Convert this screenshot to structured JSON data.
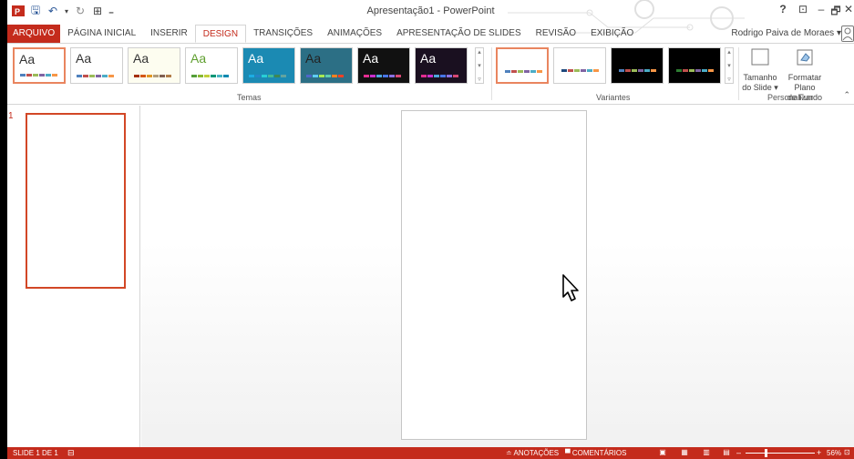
{
  "window": {
    "title": "Apresentação1 - PowerPoint",
    "help": "?",
    "ribbon_display": "⊡",
    "minimize": "–",
    "restore": "🗗",
    "close": "✕"
  },
  "qat": {
    "app_icon": "powerpoint-icon",
    "save": "🖫",
    "undo": "↶",
    "undo_dropdown": "▾",
    "redo": "↻",
    "start_slideshow": "⊞",
    "customize": "₌"
  },
  "tabs": [
    "ARQUIVO",
    "PÁGINA INICIAL",
    "INSERIR",
    "DESIGN",
    "TRANSIÇÕES",
    "ANIMAÇÕES",
    "APRESENTAÇÃO DE SLIDES",
    "REVISÃO",
    "EXIBIÇÃO"
  ],
  "active_tab": "DESIGN",
  "user": {
    "name": "Rodrigo Paiva de Moraes",
    "dropdown": "▾"
  },
  "ribbon": {
    "themes_label": "Temas",
    "theme_text": "Aa",
    "variants_label": "Variantes",
    "customize_label": "Personalizar",
    "slide_size_label_1": "Tamanho",
    "slide_size_label_2": "do Slide ▾",
    "format_bg_label_1": "Formatar Plano",
    "format_bg_label_2": "de Fundo",
    "collapse": "⌃",
    "scroll_up": "▴",
    "scroll_down": "▾",
    "scroll_more": "▿"
  },
  "themes": [
    {
      "bg": "#ffffff",
      "text": "#333333",
      "selected": true,
      "bars": [
        "#4f81bd",
        "#c0504d",
        "#9bbb59",
        "#8064a2",
        "#4bacc6",
        "#f79646"
      ]
    },
    {
      "bg": "#ffffff",
      "text": "#333333",
      "selected": false,
      "bars": [
        "#4f81bd",
        "#c0504d",
        "#9bbb59",
        "#8064a2",
        "#4bacc6",
        "#f79646"
      ]
    },
    {
      "bg": "#fdfdf0",
      "text": "#333333",
      "selected": false,
      "bars": [
        "#a5300f",
        "#d55816",
        "#e19825",
        "#b19c7d",
        "#7f5f52",
        "#b27d49"
      ]
    },
    {
      "bg": "#ffffff",
      "text": "#5f9f2f",
      "selected": false,
      "bars": [
        "#549e39",
        "#8ab833",
        "#c0cf3a",
        "#029676",
        "#4ab5c4",
        "#0989b1"
      ]
    },
    {
      "bg": "#1b8ab3",
      "text": "#ffffff",
      "selected": false,
      "bars": [
        "#1cade4",
        "#2683c6",
        "#27ced7",
        "#42ba97",
        "#3e8853",
        "#62a39f"
      ]
    },
    {
      "bg": "#2c6f85",
      "text": "#222222",
      "selected": false,
      "bars": [
        "#4e67c8",
        "#5eccf3",
        "#a7ea52",
        "#5dceaf",
        "#ff8021",
        "#f14124"
      ]
    },
    {
      "bg": "#111111",
      "text": "#ffffff",
      "selected": false,
      "bars": [
        "#e32d91",
        "#c830cc",
        "#4ea6dc",
        "#4775e7",
        "#8971e1",
        "#d54773"
      ]
    },
    {
      "bg": "#1a1020",
      "text": "#ffffff",
      "selected": false,
      "bars": [
        "#e32d91",
        "#c830cc",
        "#4ea6dc",
        "#4775e7",
        "#8971e1",
        "#d54773"
      ]
    }
  ],
  "variants": [
    {
      "bg": "#ffffff",
      "selected": true,
      "bars": [
        "#4f81bd",
        "#c0504d",
        "#9bbb59",
        "#8064a2",
        "#4bacc6",
        "#f79646"
      ]
    },
    {
      "bg": "#ffffff",
      "selected": false,
      "bars": [
        "#1f497d",
        "#c0504d",
        "#9bbb59",
        "#8064a2",
        "#4bacc6",
        "#f79646"
      ]
    },
    {
      "bg": "#000000",
      "selected": false,
      "bars": [
        "#4f81bd",
        "#c0504d",
        "#9bbb59",
        "#8064a2",
        "#4bacc6",
        "#f79646"
      ]
    },
    {
      "bg": "#000000",
      "selected": false,
      "bars": [
        "#2e7d32",
        "#c0504d",
        "#9bbb59",
        "#8064a2",
        "#4bacc6",
        "#f79646"
      ]
    }
  ],
  "slides_pane": {
    "slide_number": "1"
  },
  "status": {
    "slide": "SLIDE 1 DE 1",
    "notes": "≐ ANOTAÇÕES",
    "comments": "▀ COMENTÁRIOS",
    "zoom": "56%",
    "zoom_minus": "–",
    "zoom_plus": "+",
    "zoom_level": 0.56,
    "view_normal": "▣",
    "view_sorter": "▦",
    "view_reading": "▥",
    "view_slideshow": "▤",
    "fit": "⊡"
  },
  "colors": {
    "accent": "#c42b1c",
    "selection": "#d24726"
  }
}
